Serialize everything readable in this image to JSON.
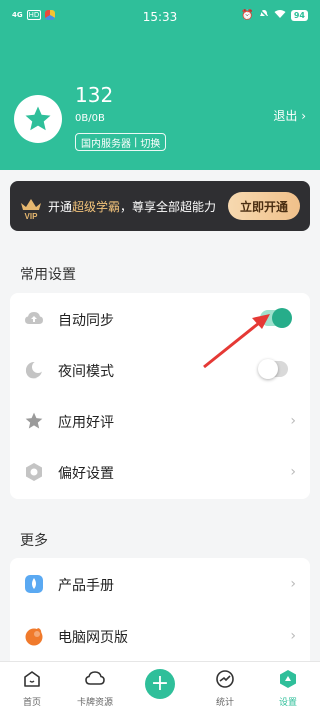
{
  "status_bar": {
    "left_signal": "4G",
    "left_hd": "HD",
    "time": "15:33",
    "battery": "94"
  },
  "profile": {
    "name": "132",
    "storage": "0B/0B",
    "server": "国内服务器",
    "switch": "切换",
    "logout": "退出"
  },
  "vip": {
    "badge": "VIP",
    "text_prefix": "开通",
    "text_highlight": "超级学霸",
    "text_suffix": "，尊享全部超能力",
    "button": "立即开通"
  },
  "sections": {
    "common_title": "常用设置",
    "common_items": [
      {
        "label": "自动同步",
        "control": "toggle",
        "on": true,
        "icon": "cloud-upload-icon"
      },
      {
        "label": "夜间模式",
        "control": "toggle",
        "on": false,
        "icon": "moon-icon"
      },
      {
        "label": "应用好评",
        "control": "chevron",
        "icon": "star-icon"
      },
      {
        "label": "偏好设置",
        "control": "chevron",
        "icon": "hexagon-settings-icon"
      }
    ],
    "more_title": "更多",
    "more_items": [
      {
        "label": "产品手册",
        "control": "chevron",
        "icon": "manual-icon"
      },
      {
        "label": "电脑网页版",
        "control": "chevron",
        "icon": "web-version-icon"
      }
    ]
  },
  "tabbar": [
    {
      "label": "首页",
      "icon": "home-icon"
    },
    {
      "label": "卡牌资源",
      "icon": "cloud-icon"
    },
    {
      "label": "",
      "icon": "plus-icon"
    },
    {
      "label": "统计",
      "icon": "stats-icon"
    },
    {
      "label": "设置",
      "icon": "settings-icon",
      "active": true
    }
  ],
  "colors": {
    "brand": "#2fbf9a",
    "toggle_on": "#26ad8a",
    "arrow": "#e53935",
    "vip_bg": "#2f2f32",
    "vip_gold": "#f1c27a"
  }
}
